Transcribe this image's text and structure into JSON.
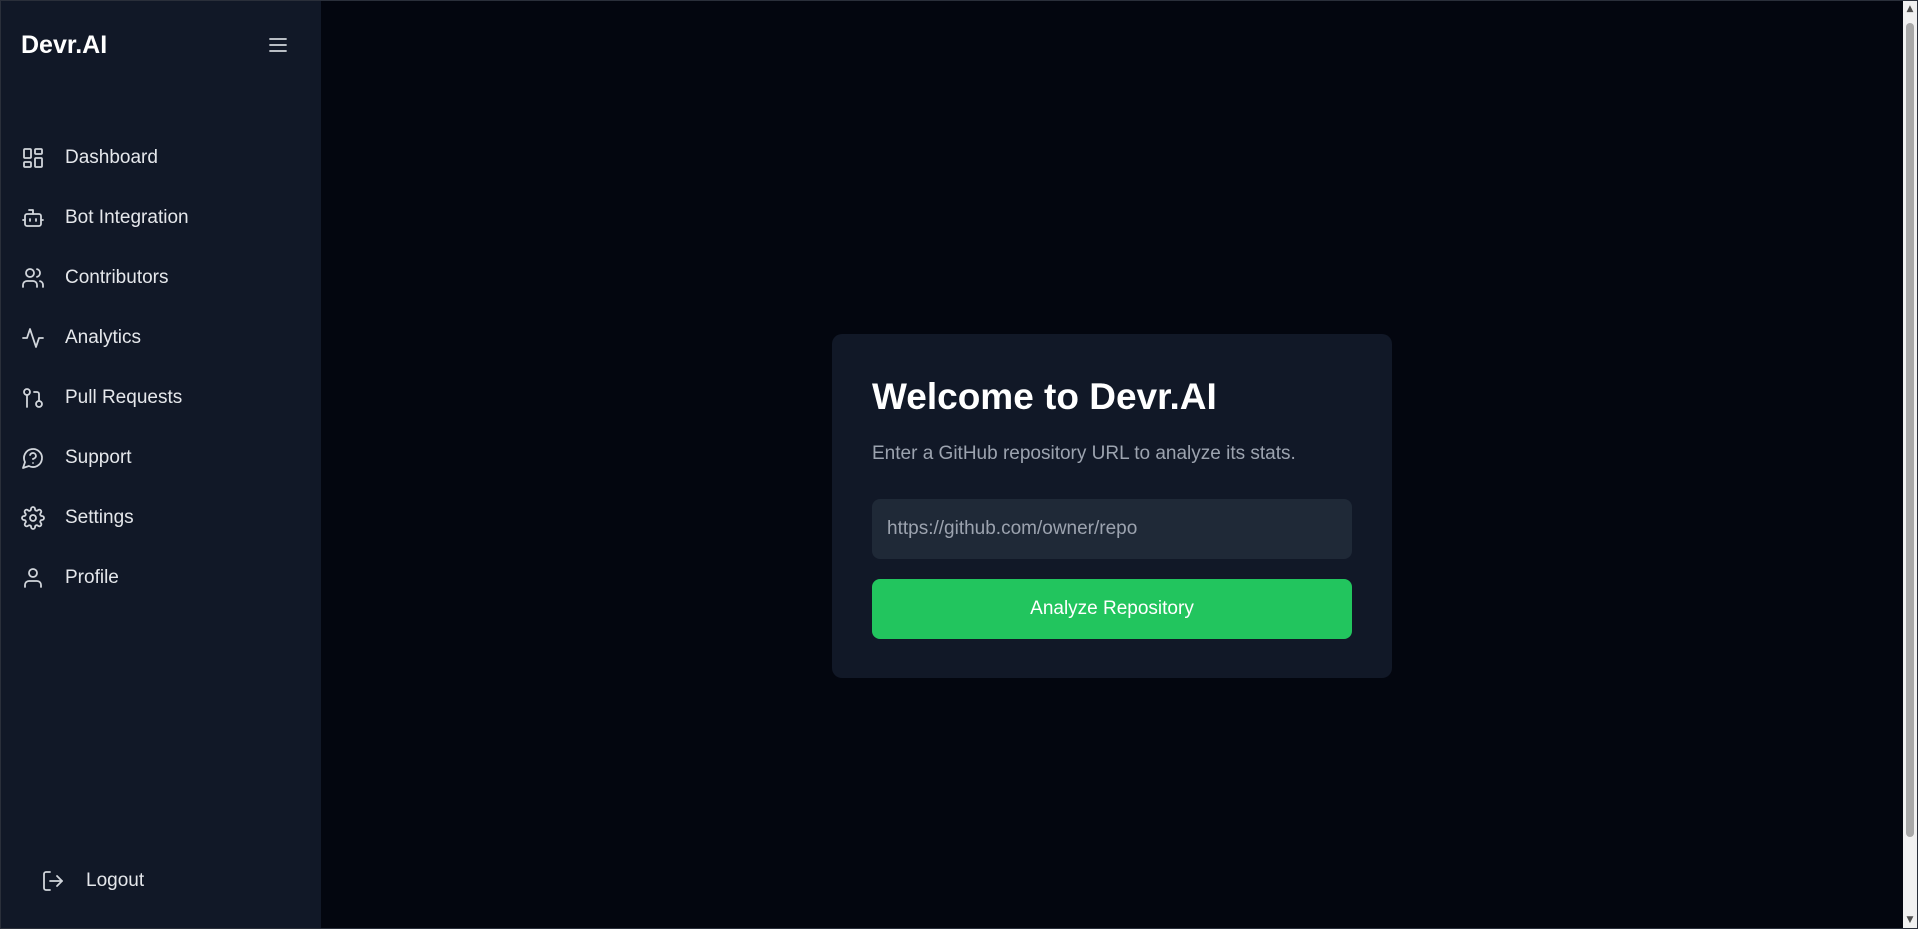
{
  "brand": {
    "name": "Devr.AI"
  },
  "sidebar": {
    "items": [
      {
        "label": "Dashboard",
        "icon": "dashboard-icon"
      },
      {
        "label": "Bot Integration",
        "icon": "bot-icon"
      },
      {
        "label": "Contributors",
        "icon": "users-icon"
      },
      {
        "label": "Analytics",
        "icon": "activity-icon"
      },
      {
        "label": "Pull Requests",
        "icon": "git-pull-request-icon"
      },
      {
        "label": "Support",
        "icon": "help-bubble-icon"
      },
      {
        "label": "Settings",
        "icon": "gear-icon"
      },
      {
        "label": "Profile",
        "icon": "user-icon"
      }
    ],
    "logout": {
      "label": "Logout",
      "icon": "logout-icon"
    }
  },
  "welcome": {
    "title": "Welcome to Devr.AI",
    "subtitle": "Enter a GitHub repository URL to analyze its stats.",
    "input_placeholder": "https://github.com/owner/repo",
    "input_value": "",
    "button_label": "Analyze Repository"
  },
  "colors": {
    "background": "#03060f",
    "sidebar": "#111827",
    "card": "#111827",
    "input": "#1f2937",
    "accent": "#22c55e"
  }
}
